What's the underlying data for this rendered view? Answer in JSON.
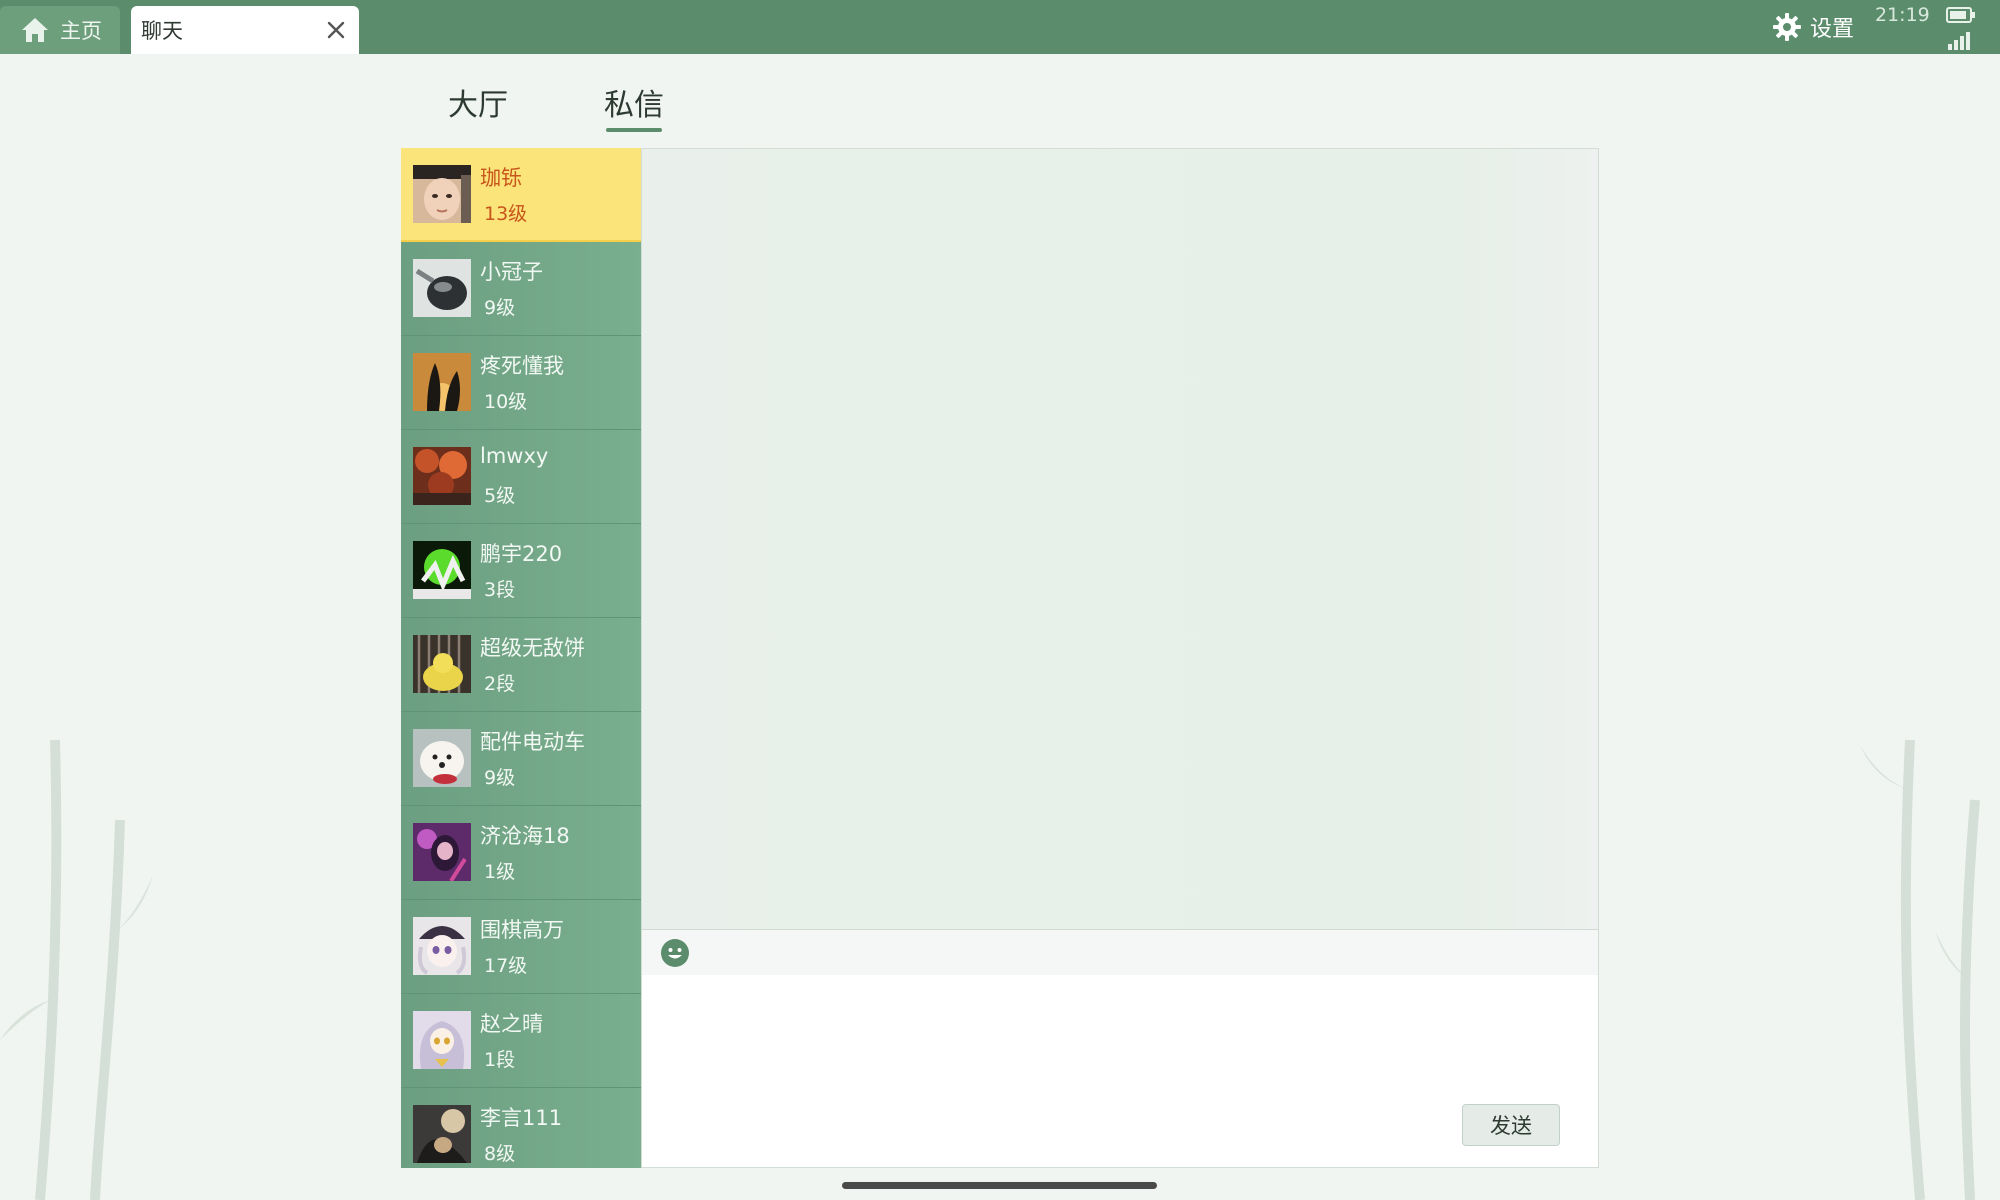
{
  "topbar": {
    "home_tab": "主页",
    "chat_tab": "聊天",
    "settings_label": "设置",
    "time": "21:19"
  },
  "section_tabs": [
    {
      "label": "大厅",
      "active": false
    },
    {
      "label": "私信",
      "active": true
    }
  ],
  "friends": [
    {
      "name": "珈铄",
      "level": "13级",
      "selected": true
    },
    {
      "name": "小冠子",
      "level": "9级"
    },
    {
      "name": "疼死懂我",
      "level": "10级"
    },
    {
      "name": "lmwxy",
      "level": "5级"
    },
    {
      "name": "鹏宇220",
      "level": "3段"
    },
    {
      "name": "超级无敌饼",
      "level": "2段"
    },
    {
      "name": "配件电动车",
      "level": "9级"
    },
    {
      "name": "济沧海18",
      "level": "1级"
    },
    {
      "name": "围棋高万",
      "level": "17级"
    },
    {
      "name": "赵之晴",
      "level": "1段"
    },
    {
      "name": "李言111",
      "level": "8级"
    }
  ],
  "chat": {
    "send_label": "发送"
  },
  "colors": {
    "topbar": "#5b8d6c",
    "list_bg": "#6ea584",
    "selected": "#fbe57a",
    "selected_text": "#c8551b"
  }
}
